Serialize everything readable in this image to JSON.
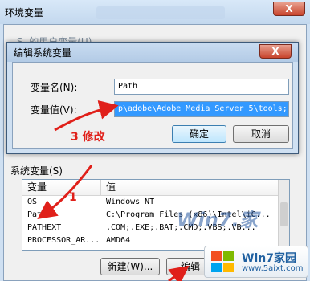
{
  "env_window": {
    "title": "环境变量",
    "close_label": "X",
    "user_vars_label": "S. 的用户变量(U)"
  },
  "system_vars": {
    "group_label": "系统变量(S)",
    "headers": {
      "variable": "变量",
      "value": "值"
    },
    "rows": [
      {
        "variable": "OS",
        "value": "Windows_NT"
      },
      {
        "variable": "Path",
        "value": "C:\\Program Files (x86)\\Intel\\iC..."
      },
      {
        "variable": "PATHEXT",
        "value": ".COM;.EXE;.BAT;.CMD;.VBS;.VB..."
      },
      {
        "variable": "PROCESSOR_AR...",
        "value": "AMD64"
      }
    ],
    "new_label": "新建(W)...",
    "edit_label": "编辑"
  },
  "dialog": {
    "title": "编辑系统变量",
    "close_label": "X",
    "name_label": "变量名(N):",
    "value_label": "变量值(V):",
    "name_value": "Path",
    "value_value": "p\\adobe\\Adobe Media Server 5\\tools;",
    "ok_label": "确定",
    "cancel_label": "取消"
  },
  "annotations": {
    "step3": "3 修改",
    "step1": "1"
  },
  "watermark": {
    "brand": "Win7家园",
    "url": "www.5aixt.com",
    "center": "Win7.家"
  },
  "colors": {
    "arrow": "#e0201a",
    "selection": "#3399ff"
  }
}
